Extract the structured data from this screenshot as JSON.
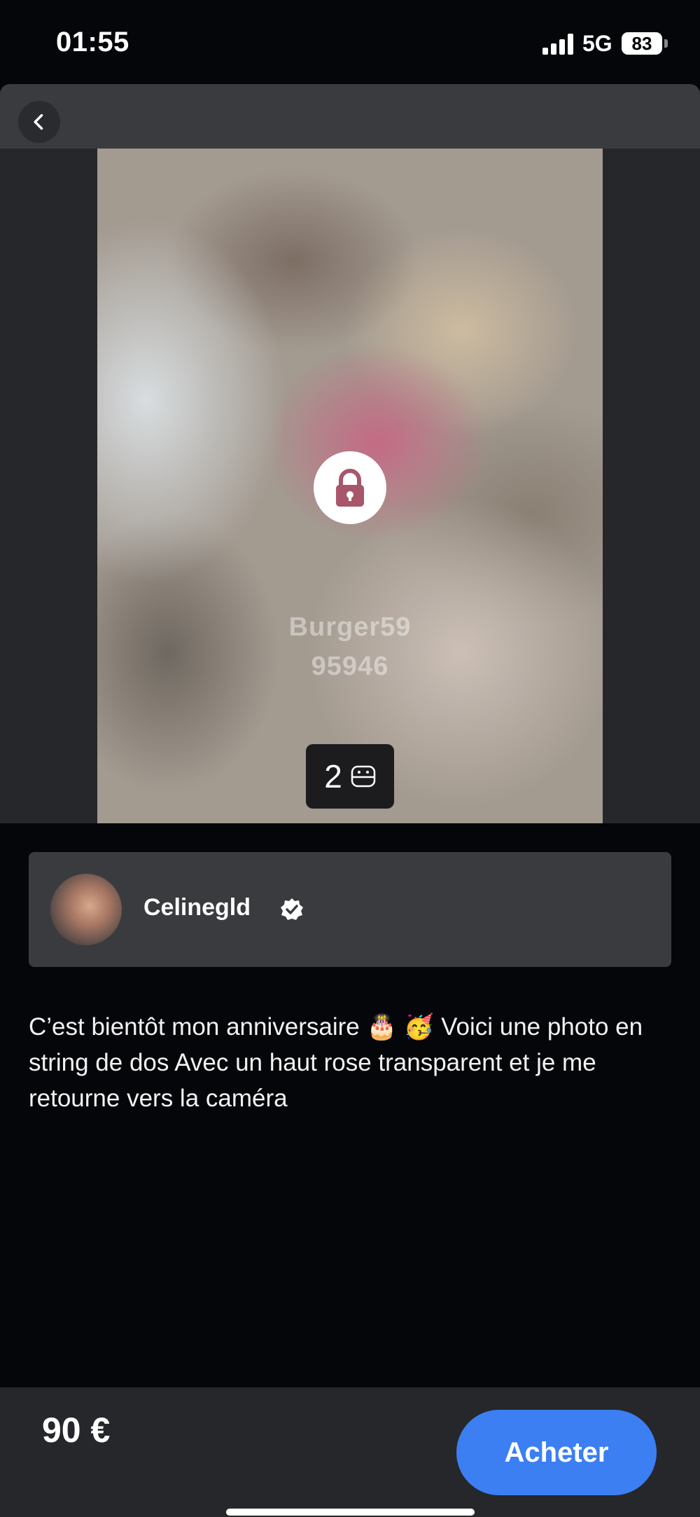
{
  "status_bar": {
    "time": "01:55",
    "network": "5G",
    "battery": "83"
  },
  "nav": {
    "back_icon": "chevron-left-icon"
  },
  "media": {
    "lock_icon": "lock-icon",
    "watermark_line1": "Burger59",
    "watermark_line2": "95946",
    "item_count": "2",
    "count_icon": "photo-stack-icon"
  },
  "creator": {
    "name": "Celinegld",
    "verified_icon": "verified-badge-icon"
  },
  "post": {
    "description": "C’est bientôt mon anniversaire 🎂 🥳 Voici une photo en string de dos Avec un haut rose transparent et je me retourne vers la caméra"
  },
  "purchase": {
    "price": "90 €",
    "buy_label": "Acheter",
    "accent_color": "#3b7ff2"
  }
}
